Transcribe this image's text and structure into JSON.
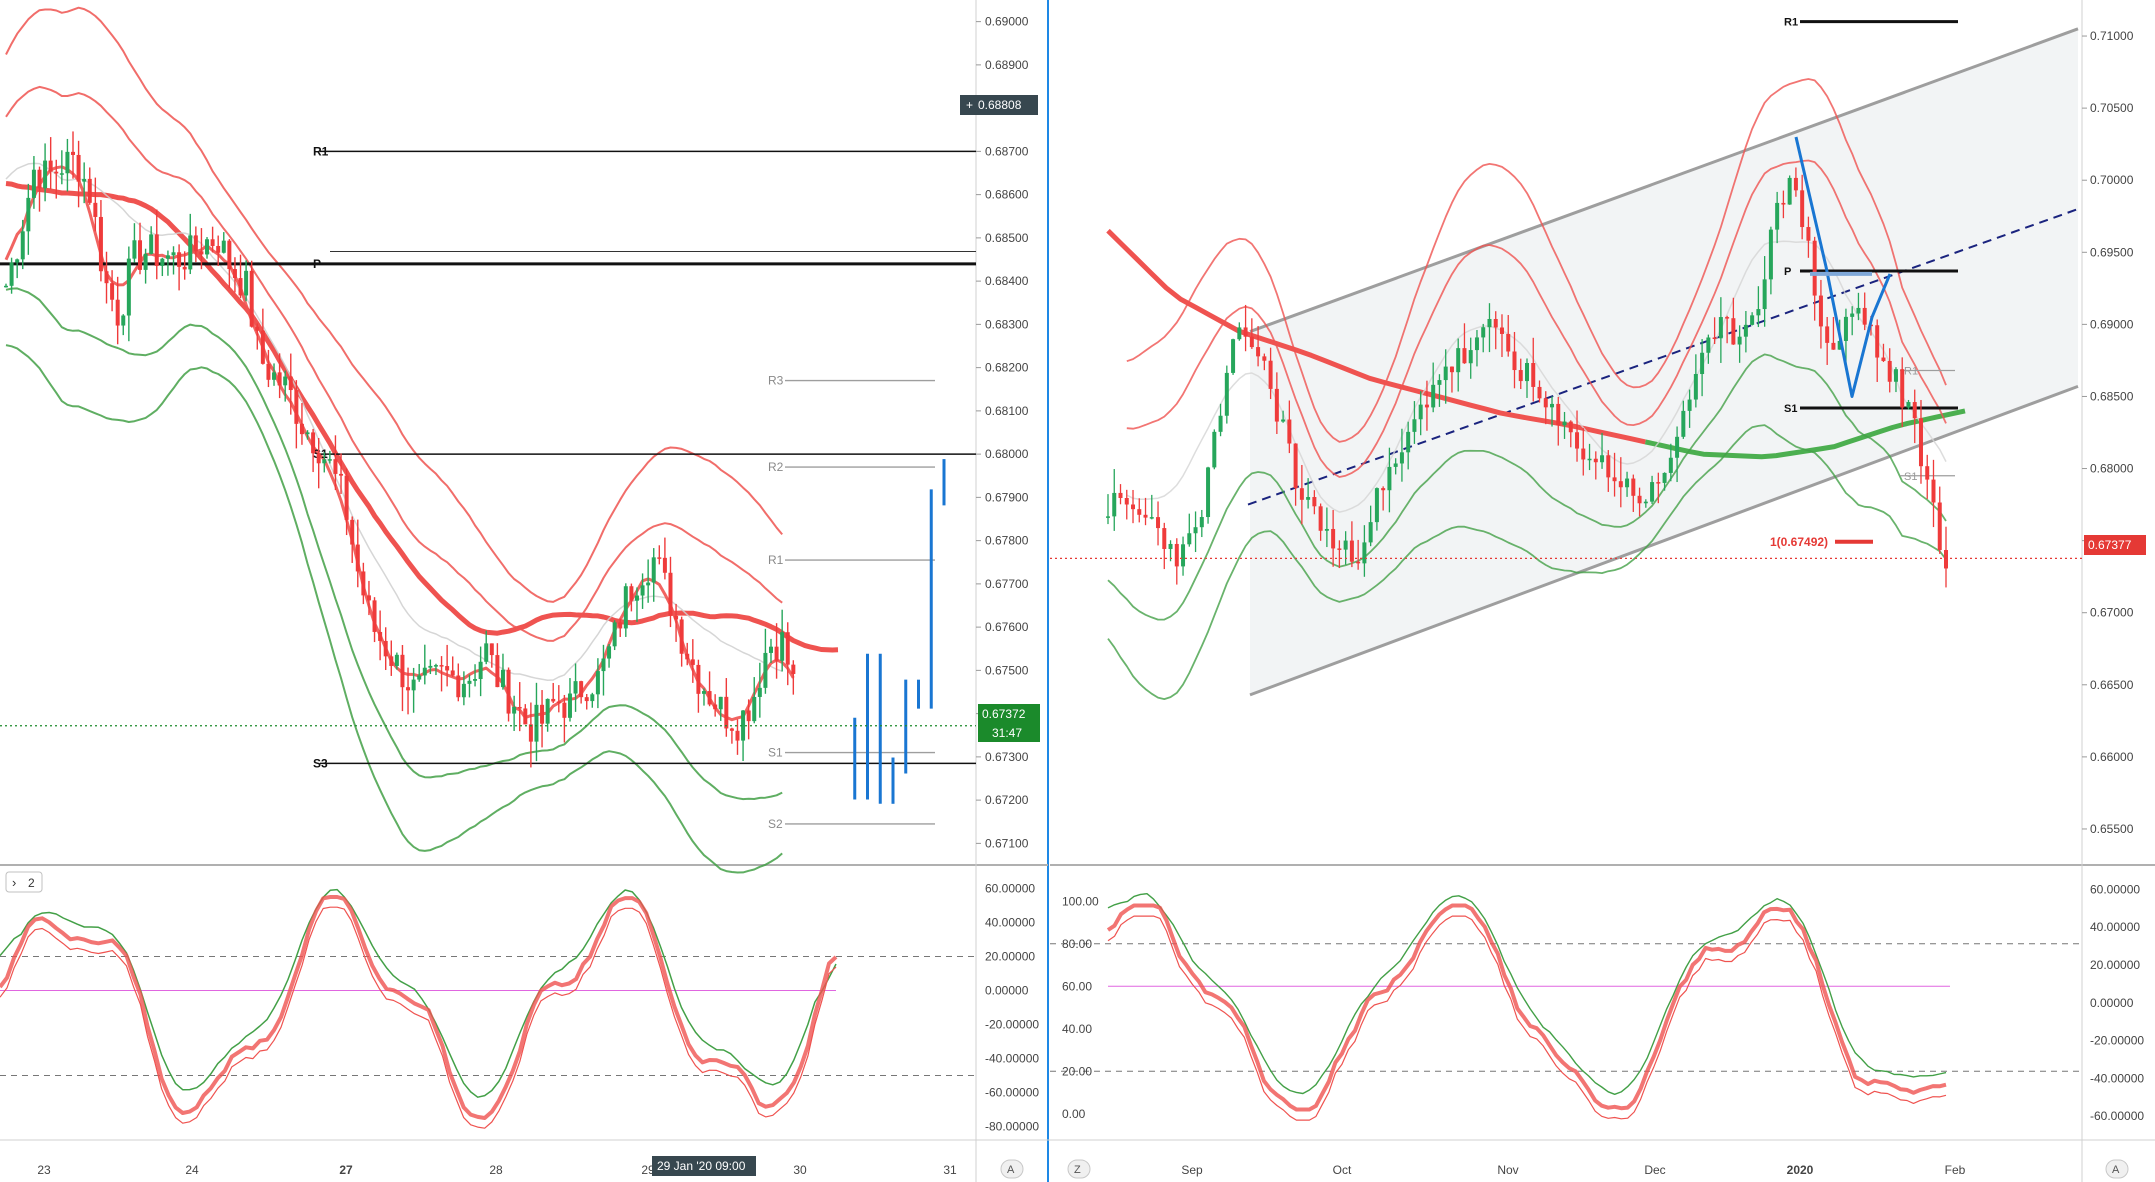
{
  "colors": {
    "band_red": "#ef5350",
    "band_green": "#43a047",
    "ma_red": "#ef5350",
    "ma_green": "#4caf50",
    "candle_up": "#26a65b",
    "candle_down": "#ef3b3b",
    "forecast_blue": "#1976d2",
    "level_dark": "#111111",
    "level_light": "#9e9e9e",
    "price_tag_green": "#1b8a2b",
    "price_tag_red": "#e53935",
    "crosshair_tag": "#37474f",
    "channel_fill": "#eceff1",
    "channel_line": "#9e9e9e",
    "divider_blue": "#1e88e5",
    "stoch_mid": "#e066e0"
  },
  "left_chart": {
    "price_axis_ticks": [
      "0.69000",
      "0.68900",
      "0.68800",
      "0.68700",
      "0.68600",
      "0.68500",
      "0.68400",
      "0.68300",
      "0.68200",
      "0.68100",
      "0.68000",
      "0.67900",
      "0.67800",
      "0.67700",
      "0.67600",
      "0.67500",
      "0.67400",
      "0.67300",
      "0.67200",
      "0.67100"
    ],
    "crosshair_price": "0.68808",
    "last_price": "0.67372",
    "countdown": "31:47",
    "time_labels": [
      "23",
      "24",
      "27",
      "28",
      "29",
      "30",
      "31"
    ],
    "hover_time": "29 Jan '20   09:00",
    "levels": [
      {
        "label": "R1",
        "price": 0.687,
        "style": "dark"
      },
      {
        "label": "P",
        "price": 0.6844,
        "style": "dark"
      },
      {
        "label": "S1",
        "price": 0.68,
        "style": "dark"
      },
      {
        "label": "S3",
        "price": 0.67285,
        "style": "dark"
      },
      {
        "label": "R3",
        "price": 0.6817,
        "style": "light"
      },
      {
        "label": "R2",
        "price": 0.6797,
        "style": "light"
      },
      {
        "label": "R1",
        "price": 0.67755,
        "style": "light"
      },
      {
        "label": "S1",
        "price": 0.6731,
        "style": "light"
      },
      {
        "label": "S2",
        "price": 0.67145,
        "style": "light"
      }
    ],
    "indicator_badge": "2",
    "osc_ticks": [
      "60.00000",
      "40.00000",
      "20.00000",
      "0.00000",
      "-20.00000",
      "-40.00000",
      "-60.00000",
      "-80.00000"
    ]
  },
  "right_chart": {
    "price_axis_ticks": [
      "0.71000",
      "0.70500",
      "0.70000",
      "0.69500",
      "0.69000",
      "0.68500",
      "0.68000",
      "0.67500",
      "0.67000",
      "0.66500",
      "0.66000",
      "0.65500"
    ],
    "last_price": "0.67377",
    "time_labels": [
      "Sep",
      "Oct",
      "Nov",
      "Dec",
      "2020",
      "Feb"
    ],
    "levels": [
      {
        "label": "R1",
        "price": 0.711,
        "style": "dark"
      },
      {
        "label": "P",
        "price": 0.6937,
        "style": "dark"
      },
      {
        "label": "S1",
        "price": 0.6842,
        "style": "dark"
      },
      {
        "label": "R1",
        "price": 0.6868,
        "style": "light"
      },
      {
        "label": "S1",
        "price": 0.6795,
        "style": "light"
      }
    ],
    "target_label": "1(0.67492)",
    "stoch_left_ticks": [
      "100.00",
      "80.00",
      "60.00",
      "40.00",
      "20.00",
      "0.00"
    ],
    "osc_ticks": [
      "60.00000",
      "40.00000",
      "20.00000",
      "0.00000",
      "-20.00000",
      "-40.00000",
      "-60.00000"
    ]
  },
  "axis_buttons": {
    "auto": "A",
    "zoom": "Z"
  },
  "chart_data": [
    {
      "type": "candlestick",
      "title": "",
      "timeframe": "hourly",
      "x_labels": [
        "23",
        "24",
        "27",
        "28",
        "29",
        "30",
        "31"
      ],
      "ylim": [
        0.6705,
        0.6905
      ],
      "grid": false,
      "close_path": [
        0.6839,
        0.6851,
        0.6866,
        0.6864,
        0.6867,
        0.6868,
        0.686,
        0.684,
        0.6832,
        0.6845,
        0.6847,
        0.6846,
        0.6845,
        0.6846,
        0.6849,
        0.685,
        0.6843,
        0.6839,
        0.6822,
        0.6818,
        0.6815,
        0.6807,
        0.6803,
        0.6797,
        0.6789,
        0.6772,
        0.676,
        0.6755,
        0.675,
        0.6745,
        0.6747,
        0.6749,
        0.6748,
        0.6749,
        0.6755,
        0.6747,
        0.6743,
        0.6737,
        0.6738,
        0.6743,
        0.6742,
        0.6747,
        0.6748,
        0.6756,
        0.6767,
        0.6773,
        0.6776,
        0.6767,
        0.6757,
        0.6749,
        0.6744,
        0.674,
        0.6738,
        0.6744,
        0.6756,
        0.6757,
        0.6745,
        0.6738,
        0.6734,
        0.67372
      ],
      "forecast_path": [
        0.67372,
        0.6722,
        0.6752,
        0.6721,
        0.6728,
        0.6746,
        0.6743,
        0.679,
        0.6797
      ],
      "pivots": {
        "R1": 0.687,
        "P": 0.6844,
        "S1": 0.68,
        "S3": 0.67285
      }
    },
    {
      "type": "candlestick",
      "title": "",
      "timeframe": "daily",
      "x_labels": [
        "Sep",
        "Oct",
        "Nov",
        "Dec",
        "2020",
        "Feb"
      ],
      "ylim": [
        0.6525,
        0.7125
      ],
      "grid": false,
      "close_path": [
        0.6775,
        0.6772,
        0.677,
        0.6765,
        0.676,
        0.6745,
        0.674,
        0.6755,
        0.6795,
        0.684,
        0.688,
        0.6895,
        0.688,
        0.6855,
        0.683,
        0.679,
        0.6775,
        0.6765,
        0.6745,
        0.674,
        0.6745,
        0.677,
        0.6785,
        0.68,
        0.682,
        0.684,
        0.686,
        0.687,
        0.6875,
        0.688,
        0.689,
        0.69,
        0.688,
        0.687,
        0.6855,
        0.684,
        0.683,
        0.682,
        0.6815,
        0.6805,
        0.68,
        0.679,
        0.6785,
        0.678,
        0.6785,
        0.681,
        0.684,
        0.6865,
        0.688,
        0.6895,
        0.6895,
        0.69,
        0.692,
        0.696,
        0.699,
        0.7,
        0.695,
        0.69,
        0.688,
        0.69,
        0.691,
        0.6895,
        0.687,
        0.686,
        0.684,
        0.681,
        0.677,
        0.67377
      ],
      "target": 0.67492,
      "pivots": {
        "R1": 0.711,
        "P": 0.6937,
        "S1": 0.6842
      }
    }
  ]
}
